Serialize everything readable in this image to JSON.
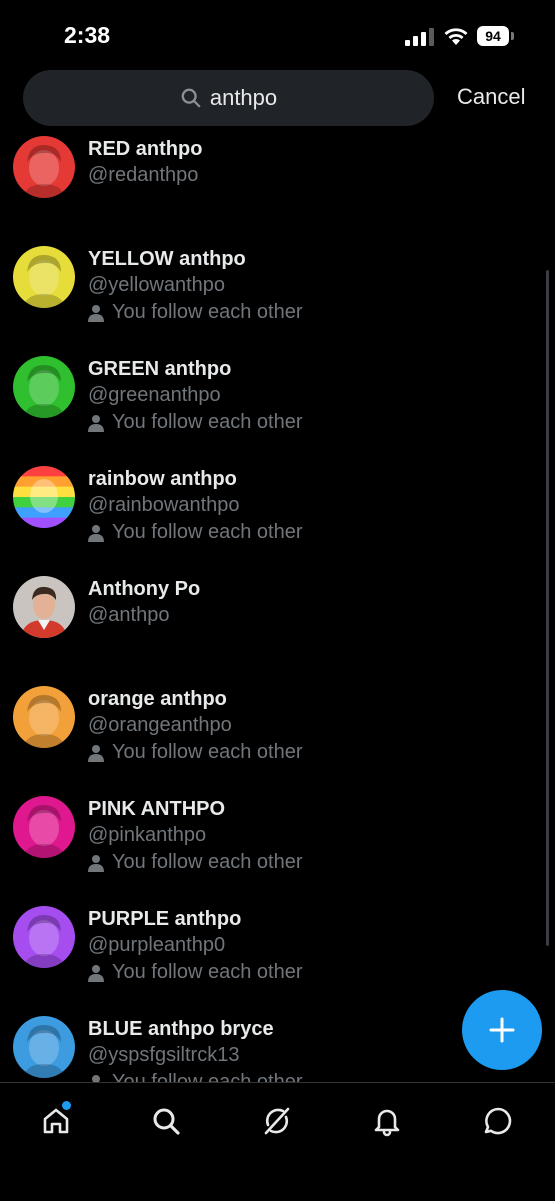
{
  "status_bar": {
    "time": "2:38",
    "battery": "94",
    "icons": [
      "signal-icon",
      "wifi-icon",
      "battery-icon"
    ]
  },
  "search": {
    "query": "anthpo",
    "cancel_label": "Cancel"
  },
  "colors": {
    "accent": "#1d9bf0",
    "background": "#000000",
    "muted": "#71767b",
    "text": "#e7e9ea",
    "search_bg": "#202327"
  },
  "results": [
    {
      "name": "RED anthpo",
      "handle": "@redanthpo",
      "follow_status": "",
      "avatar_tint": "#e53935"
    },
    {
      "name": "YELLOW anthpo",
      "handle": "@yellowanthpo",
      "follow_status": "You follow each other",
      "avatar_tint": "#e6dc3a"
    },
    {
      "name": "GREEN anthpo",
      "handle": "@greenanthpo",
      "follow_status": "You follow each other",
      "avatar_tint": "#2fbf2f"
    },
    {
      "name": "rainbow anthpo",
      "handle": "@rainbowanthpo",
      "follow_status": "You follow each other",
      "avatar_tint": "rainbow"
    },
    {
      "name": "Anthony Po",
      "handle": "@anthpo",
      "follow_status": "",
      "avatar_tint": "photo"
    },
    {
      "name": "orange anthpo",
      "handle": "@orangeanthpo",
      "follow_status": "You follow each other",
      "avatar_tint": "#f2a13a"
    },
    {
      "name": "PINK ANTHPO",
      "handle": "@pinkanthpo",
      "follow_status": "You follow each other",
      "avatar_tint": "#e0188f"
    },
    {
      "name": "PURPLE anthpo",
      "handle": "@purpleanthp0",
      "follow_status": "You follow each other",
      "avatar_tint": "#a64df0"
    },
    {
      "name": "BLUE anthpo bryce",
      "handle": "@yspsfgsiltrck13",
      "follow_status": "You follow each other",
      "avatar_tint": "#3d9be0"
    }
  ],
  "bottom_nav": [
    {
      "icon": "home-icon",
      "active": true
    },
    {
      "icon": "search-icon",
      "active": false
    },
    {
      "icon": "grok-icon",
      "active": false
    },
    {
      "icon": "bell-icon",
      "active": false
    },
    {
      "icon": "messages-icon",
      "active": false
    }
  ],
  "fab": {
    "icon": "plus-icon"
  }
}
